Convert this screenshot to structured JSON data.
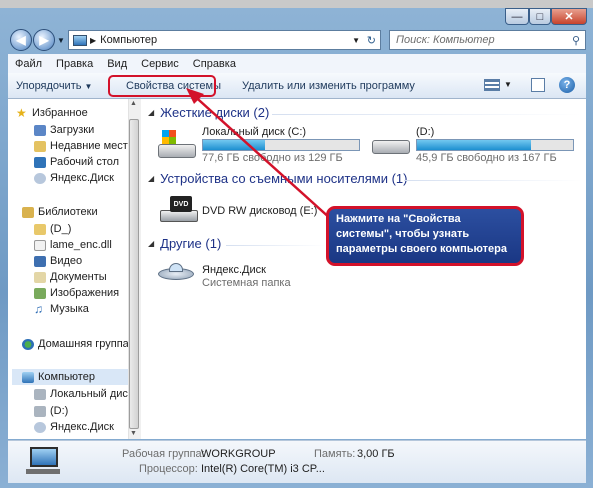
{
  "address": {
    "crumb": "Компьютер"
  },
  "search": {
    "placeholder": "Поиск: Компьютер"
  },
  "menu": [
    "Файл",
    "Правка",
    "Вид",
    "Сервис",
    "Справка"
  ],
  "toolbar": {
    "organize": "Упорядочить",
    "system_properties": "Свойства системы",
    "uninstall": "Удалить или изменить программу"
  },
  "nav": {
    "favorites": "Избранное",
    "downloads": "Загрузки",
    "recent": "Недавние места",
    "desktop": "Рабочий стол",
    "yandex": "Яндекс.Диск",
    "libraries": "Библиотеки",
    "lib_d": "(D_)",
    "lame": "lame_enc.dll",
    "video": "Видео",
    "docs": "Документы",
    "images": "Изображения",
    "music": "Музыка",
    "homegroup": "Домашняя группа",
    "computer": "Компьютер",
    "local_disk": "Локальный диск",
    "drive_d": "(D:)",
    "yandex2": "Яндекс.Диск"
  },
  "groups": {
    "hdd": "Жесткие диски (2)",
    "removable": "Устройства со съемными носителями (1)",
    "other": "Другие (1)"
  },
  "drives": [
    {
      "name": "Локальный диск (C:)",
      "free": "77,6 ГБ свободно из 129 ГБ",
      "used_fraction": 0.4
    },
    {
      "name": "(D:)",
      "free": "45,9 ГБ свободно из 167 ГБ",
      "used_fraction": 0.73
    }
  ],
  "dvd": {
    "name": "DVD RW дисковод (E:)",
    "badge": "DVD"
  },
  "yandex_item": {
    "name": "Яндекс.Диск",
    "sub": "Системная папка"
  },
  "details": {
    "workgroup_label": "Рабочая группа:",
    "workgroup_value": "WORKGROUP",
    "memory_label": "Память:",
    "memory_value": "3,00 ГБ",
    "cpu_label": "Процессор:",
    "cpu_value": "Intel(R) Core(TM) i3 CP..."
  },
  "callout": {
    "text": "Нажмите на \"Свойства системы\", чтобы узнать параметры своего компьютера"
  },
  "colors": {
    "accent_red": "#d3122a",
    "callout_blue": "#1f3d8c",
    "group_blue": "#1e3287"
  }
}
